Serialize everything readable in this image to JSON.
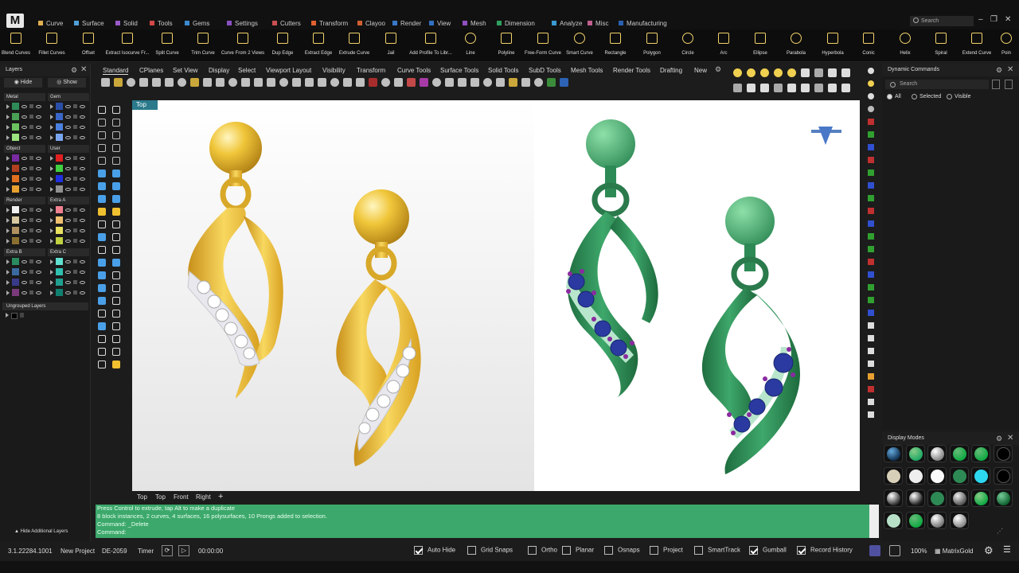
{
  "app": {
    "logo": "M"
  },
  "menu_tabs": [
    {
      "label": "Curve",
      "color": "#e0b050"
    },
    {
      "label": "Surface",
      "color": "#4fa0d8"
    },
    {
      "label": "Solid",
      "color": "#9a5ac8"
    },
    {
      "label": "Tools",
      "color": "#d04848"
    },
    {
      "label": "Gems",
      "color": "#3c8ad0"
    },
    {
      "label": "Settings",
      "color": "#8a50c0"
    },
    {
      "label": "Cutters",
      "color": "#c85050"
    },
    {
      "label": "Transform",
      "color": "#e06030"
    },
    {
      "label": "Clayoo",
      "color": "#d06030"
    },
    {
      "label": "Render",
      "color": "#3a78c8"
    },
    {
      "label": "View",
      "color": "#3070c0"
    },
    {
      "label": "Mesh",
      "color": "#9050c0"
    },
    {
      "label": "Dimension",
      "color": "#30a060"
    },
    {
      "label": "Analyze",
      "color": "#3a9ad0"
    },
    {
      "label": "Misc",
      "color": "#c06090"
    },
    {
      "label": "Manufacturing",
      "color": "#2a60b0"
    }
  ],
  "search_top": {
    "placeholder": "Search"
  },
  "ribbon": [
    "Blend Curves",
    "Fillet Curves",
    "Offset",
    "Extract Isocurve Fr...",
    "Split Curve",
    "Trim Curve",
    "Curve From 2 Views",
    "Dup Edge",
    "Extract Edge",
    "Extrude Curve",
    "Jail",
    "Add Profile To Libr...",
    "Line",
    "Polyline",
    "Free-Form Curve",
    "Smart Curve",
    "Rectangle",
    "Polygon",
    "Circle",
    "Arc",
    "Ellipse",
    "Parabola",
    "Hyperbola",
    "Conic",
    "Helix",
    "Spiral",
    "Extend Curve",
    "Poin"
  ],
  "layers": {
    "title": "Layers",
    "hide_label": "Hide",
    "show_label": "Show",
    "groups": [
      {
        "name": "Metal",
        "swatches": [
          "#2e8b57",
          "#4a9f55",
          "#6cc060",
          "#9ce27e"
        ]
      },
      {
        "name": "Gem",
        "swatches": [
          "#2a4ea8",
          "#3a66c8",
          "#4a80e0",
          "#7aa6f0"
        ]
      },
      {
        "name": "Object",
        "swatches": [
          "#7a2aa0",
          "#b04020",
          "#e07020",
          "#e8a030"
        ]
      },
      {
        "name": "User",
        "swatches": [
          "#e02020",
          "#40d040",
          "#2030e0",
          "#909090"
        ]
      },
      {
        "name": "Render",
        "swatches": [
          "#f0f0f0",
          "#d8c8a0",
          "#b09060",
          "#8a7030"
        ]
      },
      {
        "name": "Extra A",
        "swatches": [
          "#f08090",
          "#f0c070",
          "#e8e060",
          "#c0d040"
        ]
      },
      {
        "name": "Extra B",
        "swatches": [
          "#2a8a60",
          "#3a6aa0",
          "#3a3a8a",
          "#7a3a7a"
        ]
      },
      {
        "name": "Extra C",
        "swatches": [
          "#60e0d0",
          "#30c0b0",
          "#20a090",
          "#108070"
        ]
      }
    ],
    "ungrouped": "Ungrouped Layers",
    "hide_additional": "Hide Additional Layers"
  },
  "view_tabs": [
    "Standard",
    "CPlanes",
    "Set View",
    "Display",
    "Select",
    "Viewport Layout",
    "Visibility",
    "Transform",
    "Curve Tools",
    "Surface Tools",
    "Solid Tools",
    "SubD Tools",
    "Mesh Tools",
    "Render Tools",
    "Drafting",
    "New"
  ],
  "viewport": {
    "label": "Top",
    "tabs": [
      "Top",
      "Top",
      "Front",
      "Right"
    ]
  },
  "command_history": [
    "Press Control to extrude, tap Alt to make a duplicate",
    "8 block instances, 2 curves, 4 surfaces, 16 polysurfaces, 10 Prongs added to selection.",
    "Command: _Delete",
    "Command:"
  ],
  "dynamic_commands": {
    "title": "Dynamic Commands",
    "search_placeholder": "Search",
    "radios": [
      "All",
      "Selected",
      "Visible"
    ],
    "selected": "All"
  },
  "display_modes": {
    "title": "Display Modes"
  },
  "status": {
    "version": "3.1.22284.1001",
    "project": "New Project",
    "code": "DE-2059",
    "timer_label": "Timer",
    "time": "00:00:00",
    "toggles": [
      {
        "label": "Auto Hide",
        "checked": true
      },
      {
        "label": "Grid Snaps",
        "checked": false
      },
      {
        "label": "Ortho",
        "checked": false
      },
      {
        "label": "Planar",
        "checked": false
      },
      {
        "label": "Osnaps",
        "checked": false
      },
      {
        "label": "Project",
        "checked": false
      },
      {
        "label": "SmartTrack",
        "checked": false
      },
      {
        "label": "Gumball",
        "checked": true
      },
      {
        "label": "Record History",
        "checked": true
      }
    ],
    "zoom": "100%",
    "brand": "MatrixGold"
  }
}
